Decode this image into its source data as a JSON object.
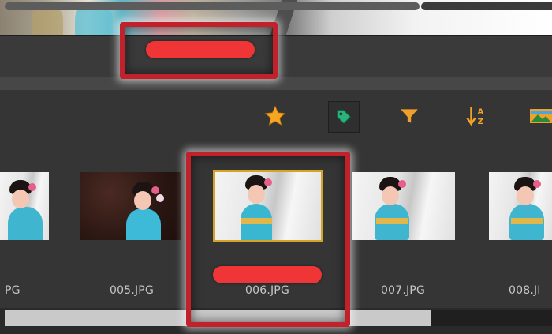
{
  "thumbnails": [
    {
      "filename": "PG",
      "variant": "light"
    },
    {
      "filename": "005.JPG",
      "variant": "dark"
    },
    {
      "filename": "006.JPG",
      "variant": "light",
      "selected": true
    },
    {
      "filename": "007.JPG",
      "variant": "light"
    },
    {
      "filename": "008.JI",
      "variant": "light"
    }
  ],
  "toolbar": {
    "icons": [
      "star-icon",
      "tag-icon",
      "filter-icon",
      "sort-az-icon",
      "image-icon"
    ]
  },
  "colors": {
    "highlight_frame": "#c2202a",
    "highlight_bar": "#ef3535",
    "selection_outline": "#d3a428",
    "star": "#f6a623",
    "tag": "#27b37a",
    "filter": "#f0a12a",
    "sort": "#f0a12a"
  }
}
